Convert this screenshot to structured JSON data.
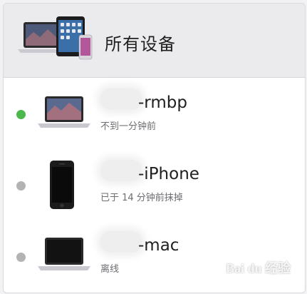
{
  "header": {
    "title": "所有设备",
    "icon": "apple-devices-icon"
  },
  "devices": [
    {
      "name_suffix": "-rmbp",
      "status": "不到一分钟前",
      "status_color": "#4cb84c",
      "icon": "macbook-pro-icon"
    },
    {
      "name_suffix": "-iPhone",
      "status": "已于 14 分钟前抹掉",
      "status_color": "#b3b3b3",
      "icon": "iphone-icon"
    },
    {
      "name_suffix": "-mac",
      "status": "离线",
      "status_color": "#b3b3b3",
      "icon": "macbook-icon"
    }
  ],
  "watermark": {
    "text": "Bai du 经验"
  }
}
